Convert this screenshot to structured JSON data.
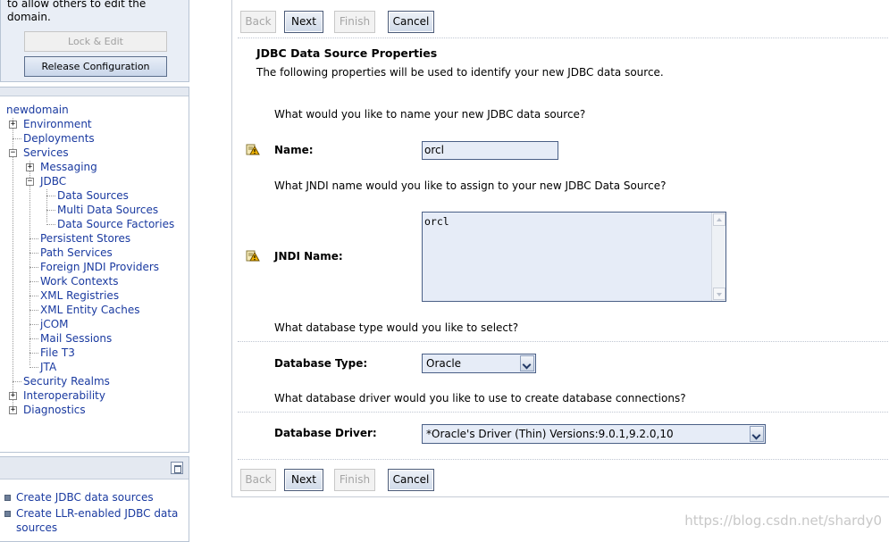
{
  "change_center": {
    "cut_text_line1": "to allow others to edit the",
    "cut_text_line2": "domain.",
    "lock_edit_label": "Lock & Edit",
    "release_config_label": "Release Configuration"
  },
  "domain_tree": {
    "root": "newdomain",
    "environment": "Environment",
    "deployments": "Deployments",
    "services": "Services",
    "messaging": "Messaging",
    "jdbc": "JDBC",
    "data_sources": "Data Sources",
    "multi_data_sources": "Multi Data Sources",
    "data_source_factories": "Data Source Factories",
    "persistent_stores": "Persistent Stores",
    "path_services": "Path Services",
    "foreign_jndi": "Foreign JNDI Providers",
    "work_contexts": "Work Contexts",
    "xml_registries": "XML Registries",
    "xml_entity_caches": "XML Entity Caches",
    "jcom": "jCOM",
    "mail_sessions": "Mail Sessions",
    "file_t3": "File T3",
    "jta": "JTA",
    "security_realms": "Security Realms",
    "interoperability": "Interoperability",
    "diagnostics": "Diagnostics"
  },
  "how_do_i": {
    "task1": "Create JDBC data sources",
    "task2": "Create LLR-enabled JDBC data sources"
  },
  "wizard": {
    "back_label": "Back",
    "next_label": "Next",
    "finish_label": "Finish",
    "cancel_label": "Cancel",
    "section_title": "JDBC Data Source Properties",
    "section_desc": "The following properties will be used to identify your new JDBC data source.",
    "q_name": "What would you like to name your new JDBC data source?",
    "name_label": "Name:",
    "name_value": "orcl",
    "q_jndi": "What JNDI name would you like to assign to your new JDBC Data Source?",
    "jndi_label": "JNDI Name:",
    "jndi_value": "orcl",
    "q_db_type": "What database type would you like to select?",
    "db_type_label": "Database Type:",
    "db_type_value": "Oracle",
    "q_driver": "What database driver would you like to use to create database connections?",
    "driver_label": "Database Driver:",
    "driver_value": "*Oracle's Driver (Thin) Versions:9.0.1,9.2.0,10"
  },
  "watermark": "https://blog.csdn.net/shardy0",
  "colors": {
    "link": "#1a3aa0",
    "panel_border": "#b8c4d4",
    "input_bg": "#e6ecf7"
  }
}
